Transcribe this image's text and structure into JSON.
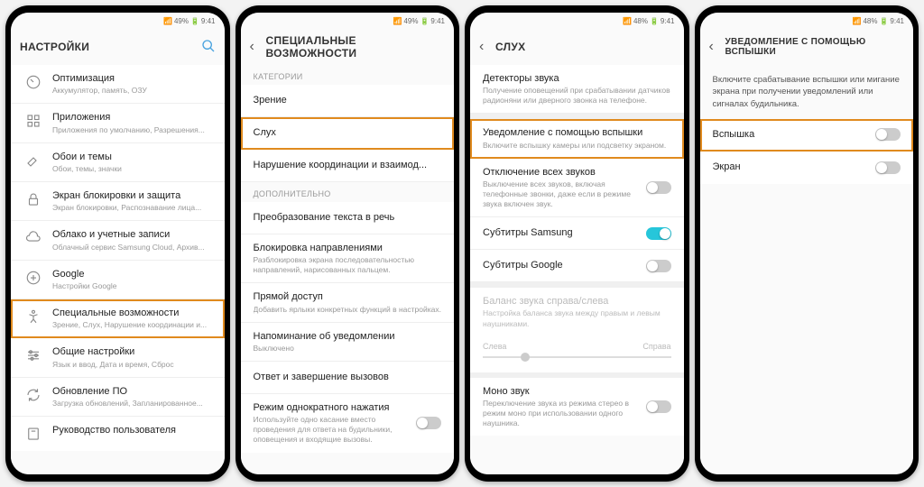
{
  "statusbar": {
    "battery": "49%",
    "battery2": "48%",
    "time": "9:41",
    "icons": "📶 ⚡"
  },
  "screens": [
    {
      "title": "НАСТРОЙКИ",
      "back": false,
      "search": true,
      "rows": [
        {
          "icon": "gauge",
          "label": "Оптимизация",
          "sub": "Аккумулятор, память, ОЗУ"
        },
        {
          "icon": "grid",
          "label": "Приложения",
          "sub": "Приложения по умолчанию, Разрешения..."
        },
        {
          "icon": "brush",
          "label": "Обои и темы",
          "sub": "Обои, темы, значки"
        },
        {
          "icon": "lock",
          "label": "Экран блокировки и защита",
          "sub": "Экран блокировки, Распознавание лица..."
        },
        {
          "icon": "cloud",
          "label": "Облако и учетные записи",
          "sub": "Облачный сервис Samsung Cloud, Архив..."
        },
        {
          "icon": "google",
          "label": "Google",
          "sub": "Настройки Google"
        },
        {
          "icon": "accessibility",
          "label": "Специальные возможности",
          "sub": "Зрение, Слух, Нарушение координации и...",
          "highlight": true
        },
        {
          "icon": "sliders",
          "label": "Общие настройки",
          "sub": "Язык и ввод, Дата и время, Сброс"
        },
        {
          "icon": "update",
          "label": "Обновление ПО",
          "sub": "Загрузка обновлений, Запланированное..."
        },
        {
          "icon": "book",
          "label": "Руководство пользователя",
          "sub": ""
        }
      ]
    },
    {
      "title": "СПЕЦИАЛЬНЫЕ ВОЗМОЖНОСТИ",
      "back": true,
      "sections": [
        {
          "label": "КАТЕГОРИИ",
          "rows": [
            {
              "label": "Зрение"
            },
            {
              "label": "Слух",
              "highlight": true
            },
            {
              "label": "Нарушение координации и взаимод..."
            }
          ]
        },
        {
          "label": "ДОПОЛНИТЕЛЬНО",
          "rows": [
            {
              "label": "Преобразование текста в речь"
            },
            {
              "label": "Блокировка направлениями",
              "sub": "Разблокировка экрана последовательностью направлений, нарисованных пальцем."
            },
            {
              "label": "Прямой доступ",
              "sub": "Добавить ярлыки конкретных функций в настройках."
            },
            {
              "label": "Напоминание об уведомлении",
              "sub": "Выключено"
            },
            {
              "label": "Ответ и завершение вызовов"
            },
            {
              "label": "Режим однократного нажатия",
              "sub": "Используйте одно касание вместо проведения для ответа на будильники, оповещения и входящие вызовы.",
              "toggle": "off"
            }
          ]
        }
      ]
    },
    {
      "title": "СЛУХ",
      "back": true,
      "rows": [
        {
          "label": "Детекторы звука",
          "sub": "Получение оповещений при срабатывании датчиков радионяни или дверного звонка на телефоне."
        },
        {
          "label": "Уведомление с помощью вспышки",
          "sub": "Включите вспышку камеры или подсветку экраном.",
          "highlight": true
        },
        {
          "label": "Отключение всех звуков",
          "sub": "Выключение всех звуков, включая телефонные звонки, даже если в режиме звука включен звук.",
          "toggle": "off"
        },
        {
          "label": "Субтитры Samsung",
          "toggle": "on"
        },
        {
          "label": "Субтитры Google",
          "toggle": "off"
        },
        {
          "type": "balance",
          "label": "Баланс звука справа/слева",
          "sub": "Настройка баланса звука между правым и левым наушниками.",
          "left": "Слева",
          "right": "Справа",
          "disabled": true
        },
        {
          "label": "Моно звук",
          "sub": "Переключение звука из режима стерео в режим моно при использовании одного наушника.",
          "toggle": "off"
        }
      ]
    },
    {
      "title": "УВЕДОМЛЕНИЕ С ПОМОЩЬЮ ВСПЫШКИ",
      "back": true,
      "desc": "Включите срабатывание вспышки или мигание экрана при получении уведомлений или сигналах будильника.",
      "rows": [
        {
          "label": "Вспышка",
          "toggle": "off",
          "highlight": true
        },
        {
          "label": "Экран",
          "toggle": "off"
        }
      ]
    }
  ]
}
